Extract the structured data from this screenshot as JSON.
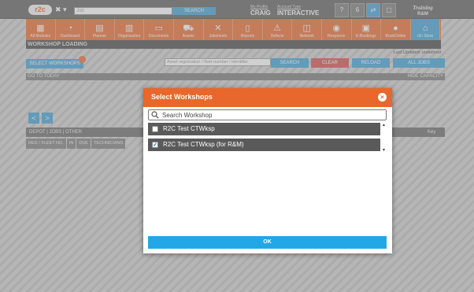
{
  "header": {
    "logo_text": "r2c",
    "search_value": "Job",
    "search_button": "SEARCH",
    "profile_label": "My Profile",
    "profile_name": "CRAIG",
    "account_type_label": "Account Type",
    "account_type_value": "INTERACTIVE",
    "training_line1": "Training",
    "training_line2": "R&M",
    "top_icons": [
      "?",
      "6",
      "⇄",
      "▢"
    ]
  },
  "modules": [
    {
      "label": "All Modules",
      "icon": "grid-icon",
      "glyph": "▦"
    },
    {
      "label": "Dashboard",
      "icon": "gauge-icon",
      "glyph": "◔"
    },
    {
      "label": "Planner",
      "icon": "calendar-icon",
      "glyph": "▤"
    },
    {
      "label": "Organisation",
      "icon": "org-chart-icon",
      "glyph": "▥"
    },
    {
      "label": "Documents",
      "icon": "folder-icon",
      "glyph": "▭"
    },
    {
      "label": "Assets",
      "icon": "truck-icon",
      "glyph": "⛟"
    },
    {
      "label": "Jobsheets",
      "icon": "tools-icon",
      "glyph": "✕"
    },
    {
      "label": "Reports",
      "icon": "clipboard-icon",
      "glyph": "▯"
    },
    {
      "label": "Defects",
      "icon": "warning-icon",
      "glyph": "⚠"
    },
    {
      "label": "Network",
      "icon": "network-icon",
      "glyph": "◫"
    },
    {
      "label": "Response",
      "icon": "response-icon",
      "glyph": "◉"
    },
    {
      "label": "E-Bookings",
      "icon": "booking-icon",
      "glyph": "▣"
    },
    {
      "label": "BookOnline",
      "icon": "book-online-icon",
      "glyph": "●"
    },
    {
      "label": "r2c Store",
      "icon": "store-icon",
      "glyph": "⌂"
    }
  ],
  "page": {
    "title": "WORKSHOP LOADING",
    "last_updated": "Last Updated: undefined",
    "select_workshops": "SELECT WORKSHOPS",
    "asset_placeholder": "Asset registration / fleet number / identifier",
    "search": "SEARCH",
    "clear": "CLEAR",
    "reload": "RELOAD",
    "all_jobs": "ALL JOBS",
    "goto_today": "GO TO TODAY",
    "hide_capacity": "HIDE CAPACITY",
    "prev": "<",
    "next": ">",
    "grid_header": "DEPOT  |  JOBS  |  OTHER",
    "grid_key": "Key",
    "columns": [
      "REG / FLEET NO.",
      "IN",
      "DUE",
      "TECHNICIANS"
    ]
  },
  "modal": {
    "title": "Select Workshops",
    "search_placeholder": "Search Workshop",
    "items": [
      {
        "label": "R2C Test CTWksp",
        "checked": false
      },
      {
        "label": "R2C Test CTWksp (for R&M)",
        "checked": true
      }
    ],
    "ok": "OK"
  },
  "colors": {
    "brand_orange": "#e9672a",
    "accent_blue": "#3b9fd6",
    "danger_red": "#d64a4a"
  }
}
